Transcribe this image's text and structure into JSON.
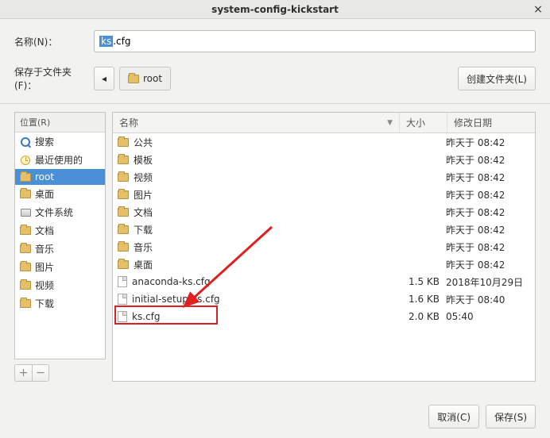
{
  "window": {
    "title": "system-config-kickstart",
    "close": "×"
  },
  "labels": {
    "name": "名称(N)：",
    "save_in": "保存于文件夹(F)：",
    "create_folder": "创建文件夹(L)",
    "cancel": "取消(C)",
    "save": "保存(S)"
  },
  "filename": {
    "selected": "ks",
    "rest": ".cfg"
  },
  "path": {
    "back": "◂",
    "current": "root"
  },
  "sidebar": {
    "header": "位置(R)",
    "items": [
      {
        "icon": "search",
        "label": "搜索"
      },
      {
        "icon": "clock",
        "label": "最近使用的"
      },
      {
        "icon": "folder",
        "label": "root",
        "selected": true
      },
      {
        "icon": "folder",
        "label": "桌面"
      },
      {
        "icon": "drive",
        "label": "文件系统"
      },
      {
        "icon": "folder",
        "label": "文档"
      },
      {
        "icon": "folder",
        "label": "音乐"
      },
      {
        "icon": "folder",
        "label": "图片"
      },
      {
        "icon": "folder",
        "label": "视频"
      },
      {
        "icon": "folder",
        "label": "下载"
      }
    ],
    "add": "+",
    "remove": "−"
  },
  "filelist": {
    "cols": {
      "name": "名称",
      "size": "大小",
      "date": "修改日期",
      "sort": "▼"
    },
    "rows": [
      {
        "type": "folder",
        "name": "公共",
        "size": "",
        "date": "昨天于 08:42"
      },
      {
        "type": "folder",
        "name": "模板",
        "size": "",
        "date": "昨天于 08:42"
      },
      {
        "type": "folder",
        "name": "视频",
        "size": "",
        "date": "昨天于 08:42"
      },
      {
        "type": "folder",
        "name": "图片",
        "size": "",
        "date": "昨天于 08:42"
      },
      {
        "type": "folder",
        "name": "文档",
        "size": "",
        "date": "昨天于 08:42"
      },
      {
        "type": "folder",
        "name": "下载",
        "size": "",
        "date": "昨天于 08:42"
      },
      {
        "type": "folder",
        "name": "音乐",
        "size": "",
        "date": "昨天于 08:42"
      },
      {
        "type": "folder",
        "name": "桌面",
        "size": "",
        "date": "昨天于 08:42"
      },
      {
        "type": "file",
        "name": "anaconda-ks.cfg",
        "size": "1.5 KB",
        "date": "2018年10月29日"
      },
      {
        "type": "file",
        "name": "initial-setup-ks.cfg",
        "size": "1.6 KB",
        "date": "昨天于 08:40"
      },
      {
        "type": "file",
        "name": "ks.cfg",
        "size": "2.0 KB",
        "date": "05:40",
        "highlight": true
      }
    ]
  }
}
